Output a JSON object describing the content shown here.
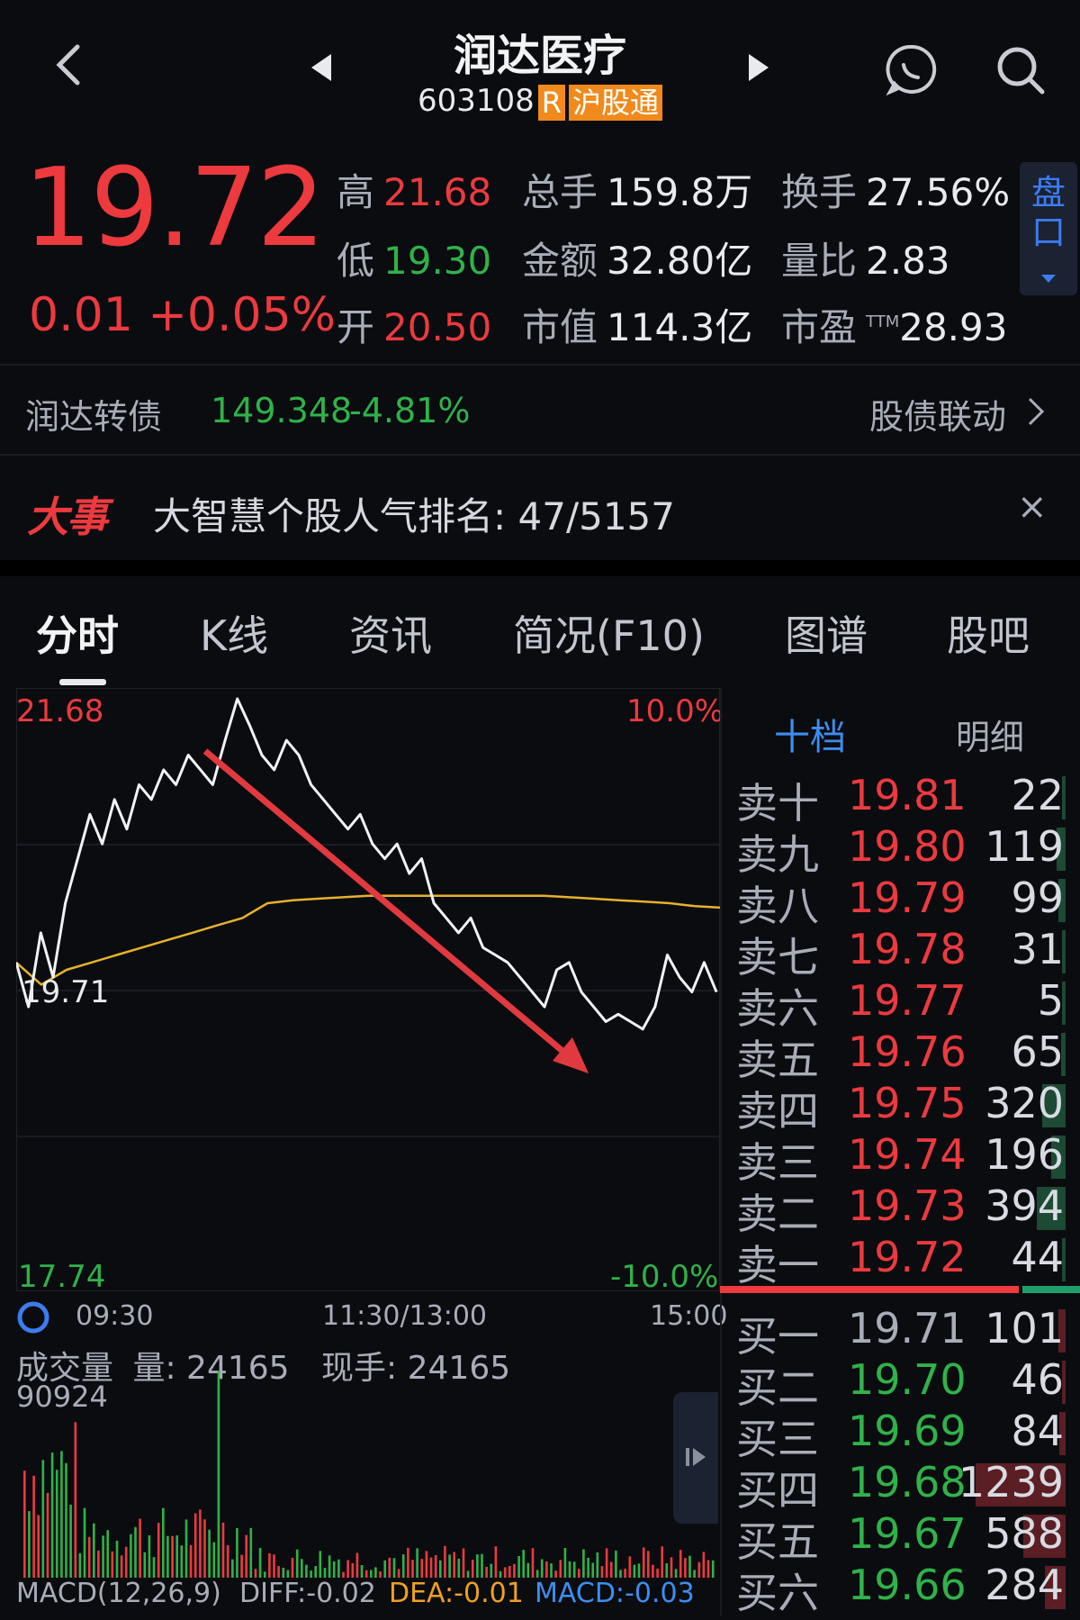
{
  "header": {
    "title": "润达医疗",
    "code": "603108",
    "tag_r": "R",
    "tag_market": "沪股通"
  },
  "quote": {
    "price": "19.72",
    "change": "0.01",
    "change_pct": "+0.05%",
    "stats": [
      {
        "label": "高",
        "value": "21.68",
        "color": "red"
      },
      {
        "label": "总手",
        "value": "159.8万",
        "color": "white"
      },
      {
        "label": "换手",
        "value": "27.56%",
        "color": "white"
      },
      {
        "label": "低",
        "value": "19.30",
        "color": "green"
      },
      {
        "label": "金额",
        "value": "32.80亿",
        "color": "white"
      },
      {
        "label": "量比",
        "value": "2.83",
        "color": "white"
      },
      {
        "label": "开",
        "value": "20.50",
        "color": "red"
      },
      {
        "label": "市值",
        "value": "114.3亿",
        "color": "white"
      },
      {
        "label": "市盈",
        "value": "28.93",
        "color": "white",
        "sup": "TTM"
      }
    ],
    "pankou": "盘口"
  },
  "bond": {
    "name": "润达转债",
    "price": "149.348",
    "pct": "-4.81%",
    "link": "股债联动"
  },
  "event": {
    "logo": "大事",
    "text": "大智慧个股人气排名:  47/5157"
  },
  "tabs": [
    "分时",
    "K线",
    "资讯",
    "简况(F10)",
    "图谱",
    "股吧"
  ],
  "chart_axes": {
    "ymax": "21.68",
    "ymax_pct": "10.0%",
    "ymin": "17.74",
    "ymin_pct": "-10.0%",
    "prev_close": "19.71",
    "t_start": "09:30",
    "t_mid": "11:30/13:00",
    "t_end": "15:00"
  },
  "volume": {
    "label": "成交量",
    "vol_text": "量: 24165",
    "cur_text": "现手: 24165",
    "max": "90924"
  },
  "macd": {
    "label": "MACD(12,26,9)",
    "diff": "DIFF:-0.02",
    "dea": "DEA:-0.01",
    "macd": "MACD:-0.03"
  },
  "orderbook": {
    "tab_active": "十档",
    "tab_other": "明细",
    "asks": [
      {
        "name": "卖十",
        "price": "19.81",
        "vol": "22",
        "fill": 0.02
      },
      {
        "name": "卖九",
        "price": "19.80",
        "vol": "119",
        "fill": 0.1
      },
      {
        "name": "卖八",
        "price": "19.79",
        "vol": "99",
        "fill": 0.08
      },
      {
        "name": "卖七",
        "price": "19.78",
        "vol": "31",
        "fill": 0.03
      },
      {
        "name": "卖六",
        "price": "19.77",
        "vol": "5",
        "fill": 0.01
      },
      {
        "name": "卖五",
        "price": "19.76",
        "vol": "65",
        "fill": 0.05
      },
      {
        "name": "卖四",
        "price": "19.75",
        "vol": "320",
        "fill": 0.26
      },
      {
        "name": "卖三",
        "price": "19.74",
        "vol": "196",
        "fill": 0.16
      },
      {
        "name": "卖二",
        "price": "19.73",
        "vol": "394",
        "fill": 0.32
      },
      {
        "name": "卖一",
        "price": "19.72",
        "vol": "44",
        "fill": 0.04
      }
    ],
    "bids": [
      {
        "name": "买一",
        "price": "19.71",
        "vol": "101",
        "fill": 0.08,
        "pcolor": "gray"
      },
      {
        "name": "买二",
        "price": "19.70",
        "vol": "46",
        "fill": 0.04,
        "pcolor": "green"
      },
      {
        "name": "买三",
        "price": "19.69",
        "vol": "84",
        "fill": 0.07,
        "pcolor": "green"
      },
      {
        "name": "买四",
        "price": "19.68",
        "vol": "1239",
        "fill": 1.0,
        "pcolor": "green"
      },
      {
        "name": "买五",
        "price": "19.67",
        "vol": "588",
        "fill": 0.47,
        "pcolor": "green"
      },
      {
        "name": "买六",
        "price": "19.66",
        "vol": "284",
        "fill": 0.23,
        "pcolor": "green"
      }
    ],
    "ask_ratio": 0.83
  },
  "chart_data": {
    "type": "line",
    "ylim": [
      17.74,
      21.68
    ],
    "prev_close": 19.71,
    "series": [
      {
        "values": [
          19.9,
          19.6,
          20.1,
          19.8,
          20.3,
          20.6,
          20.9,
          20.7,
          21.0,
          20.8,
          21.1,
          21.0,
          21.2,
          21.1,
          21.3,
          21.2,
          21.1,
          21.4,
          21.68,
          21.5,
          21.3,
          21.2,
          21.4,
          21.3,
          21.1,
          21.0,
          20.9,
          20.8,
          20.9,
          20.7,
          20.6,
          20.7,
          20.5,
          20.6,
          20.3,
          20.2,
          20.1,
          20.2,
          20.0,
          19.95,
          19.9,
          19.8,
          19.7,
          19.6,
          19.85,
          19.9,
          19.7,
          19.6,
          19.5,
          19.55,
          19.5,
          19.45,
          19.6,
          19.95,
          19.8,
          19.7,
          19.9,
          19.7
        ]
      },
      {
        "values": [
          19.9,
          19.75,
          19.85,
          19.9,
          19.95,
          20.0,
          20.05,
          20.1,
          20.15,
          20.2,
          20.3,
          20.32,
          20.33,
          20.34,
          20.35,
          20.35,
          20.35,
          20.35,
          20.35,
          20.35,
          20.35,
          20.35,
          20.34,
          20.33,
          20.32,
          20.31,
          20.3,
          20.28,
          20.27
        ]
      }
    ]
  }
}
